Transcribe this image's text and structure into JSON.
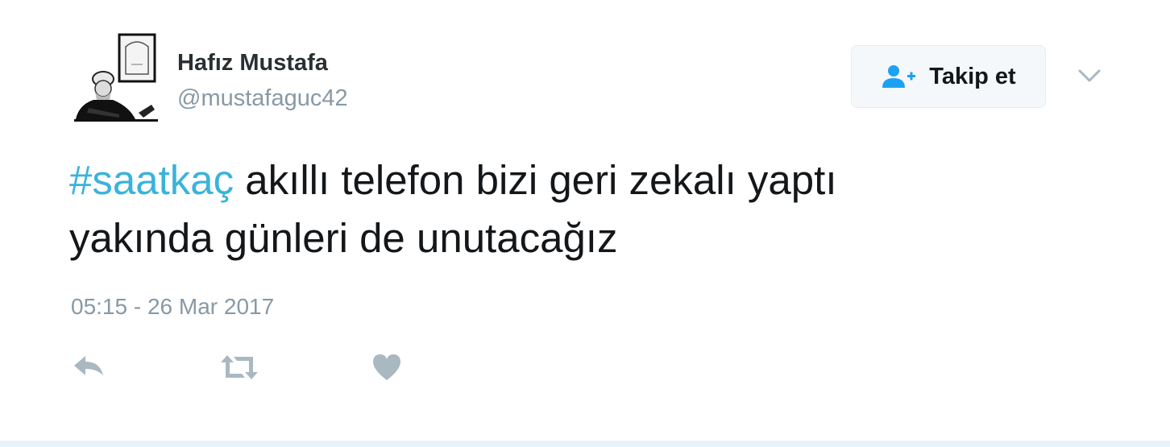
{
  "author": {
    "name": "Hafız Mustafa",
    "handle": "@mustafaguc42"
  },
  "follow_button": {
    "label": "Takip et",
    "icon": "follow-person-plus-icon"
  },
  "menu": {
    "icon": "chevron-down-icon"
  },
  "tweet": {
    "hashtag": "#saatkaç",
    "text_line1": " akıllı telefon bizi geri zekalı yaptı",
    "text_line2": "yakında günleri de unutacağız",
    "timestamp": "05:15 - 26 Mar 2017"
  },
  "actions": [
    {
      "name": "reply",
      "icon": "reply-icon"
    },
    {
      "name": "retweet",
      "icon": "retweet-icon"
    },
    {
      "name": "like",
      "icon": "heart-icon"
    }
  ],
  "colors": {
    "hashtag": "#3ab3db",
    "follow_icon": "#1da1f2",
    "muted": "#8899a6",
    "action_icon": "#aab8c2"
  }
}
